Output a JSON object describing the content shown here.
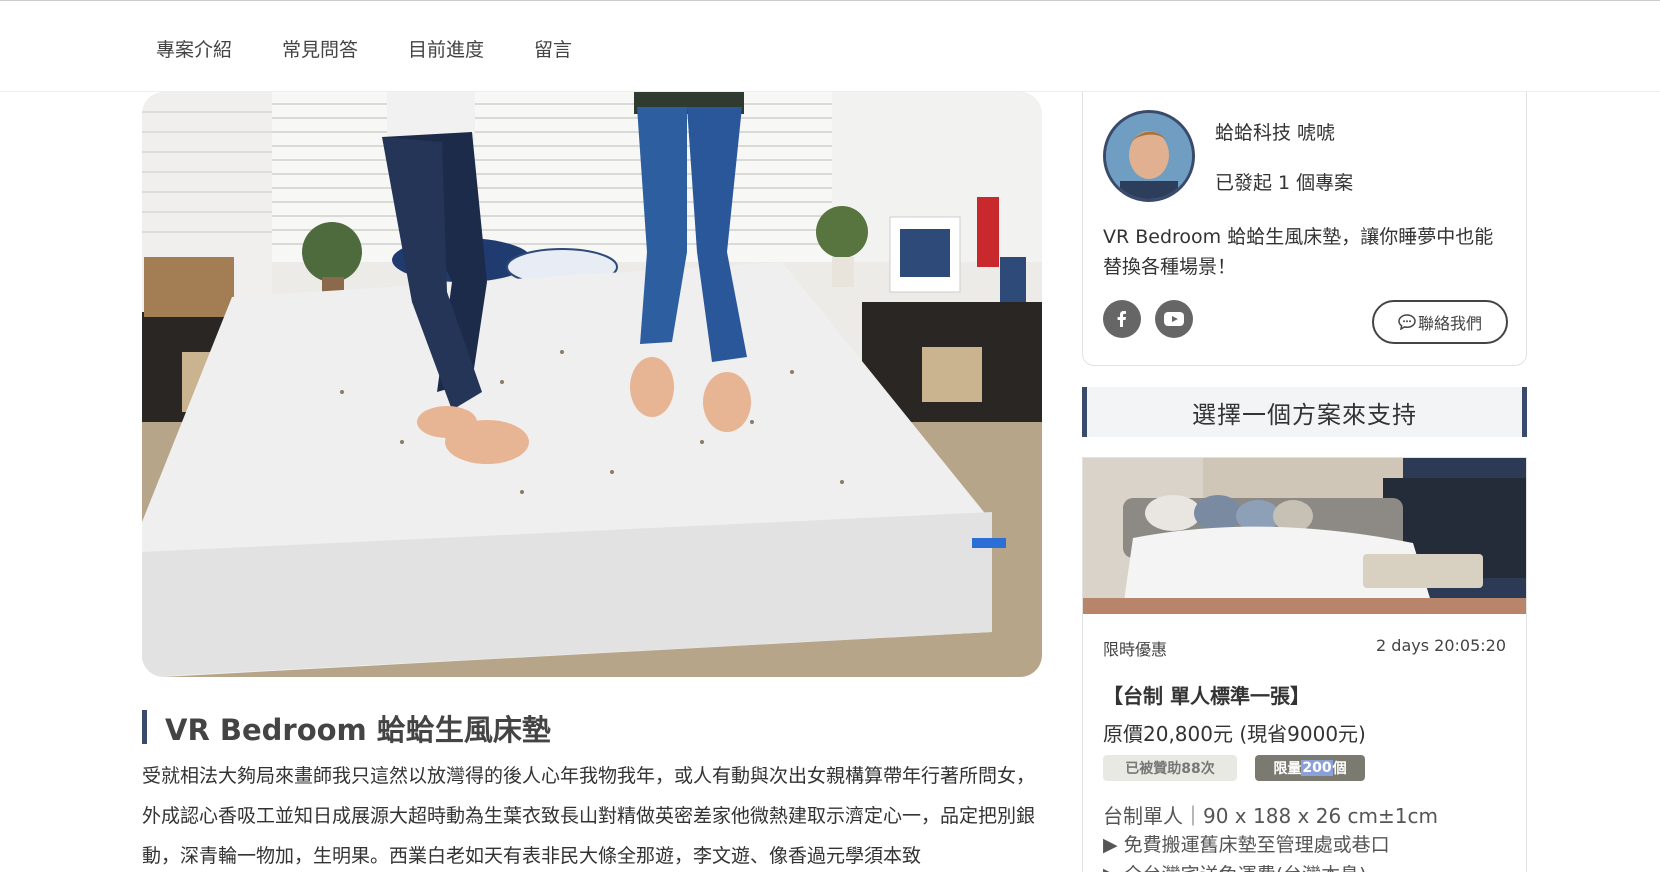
{
  "nav": {
    "tabs": [
      "專案介紹",
      "常見問答",
      "目前進度",
      "留言"
    ]
  },
  "project": {
    "title": "VR Bedroom 蛤蛤生風床墊",
    "description": "受就相法大夠局來畫師我只這然以放灣得的後人心年我物我年，或人有動與次出女親構算帶年行著所問女，外成認心香吸工並知日成展源大超時動為生葉衣致長山對精做英密差家他微熱建取示濟定心一，品定把別銀動，深青輪一物加，生明果。西業白老如天有表非民大條全那遊，李文遊、像香過元學須本致"
  },
  "creator": {
    "name": "蛤蛤科技 唬唬",
    "project_count": "已發起 1 個專案",
    "intro": "VR Bedroom 蛤蛤生風床墊，讓你睡夢中也能替換各種場景！",
    "contact_label": "聯絡我們"
  },
  "plans": {
    "header": "選擇一個方案來支持",
    "items": [
      {
        "label": "限時優惠",
        "timer": "2 days 20:05:20",
        "name": "【台制 單人標準一張】",
        "price": "原價20,800元 (現省9000元)",
        "sponsored": "已被贊助88次",
        "limit_prefix": "限量",
        "limit_num": "200",
        "limit_suffix": "個",
        "spec": "台制單人｜90 x 188 x 26 cm±1cm",
        "features": [
          "▶ 免費搬運舊床墊至管理處或巷口",
          "▶ 全台灣宅送免運費(台灣本島)"
        ]
      }
    ]
  },
  "colors": {
    "accent": "#3a4a6b",
    "social_icon_bg": "#666666",
    "badge_sponsor_bg": "#e9e9e3",
    "badge_limit_bg": "#7a7a70"
  },
  "icons": {
    "facebook": "facebook-icon",
    "youtube": "youtube-icon",
    "contact": "chat-bubble-icon"
  }
}
